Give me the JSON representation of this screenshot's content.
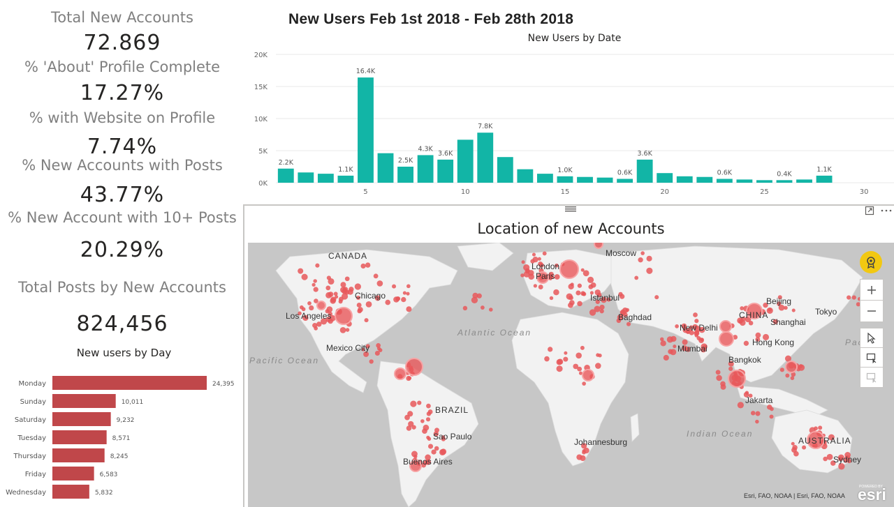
{
  "kpis": [
    {
      "label": "Total New Accounts",
      "value": "72.869"
    },
    {
      "label": "% 'About' Profile Complete",
      "value": "17.27%"
    },
    {
      "label": "% with Website on Profile",
      "value": "7.74%"
    },
    {
      "label": "% New Accounts with Posts",
      "value": "43.77%"
    },
    {
      "label": "% New Account with 10+ Posts",
      "value": "20.29%"
    },
    {
      "label": "Total Posts by New Accounts",
      "value": "824,456"
    }
  ],
  "day_chart": {
    "title": "New users by Day",
    "bar_color": "#c0474a",
    "items": [
      {
        "day": "Monday",
        "value": 24395,
        "label": "24,395"
      },
      {
        "day": "Sunday",
        "value": 10011,
        "label": "10,011"
      },
      {
        "day": "Saturday",
        "value": 9232,
        "label": "9,232"
      },
      {
        "day": "Tuesday",
        "value": 8571,
        "label": "8,571"
      },
      {
        "day": "Thursday",
        "value": 8245,
        "label": "8,245"
      },
      {
        "day": "Friday",
        "value": 6583,
        "label": "6,583"
      },
      {
        "day": "Wednesday",
        "value": 5832,
        "label": "5,832"
      }
    ]
  },
  "main_title": "New Users Feb 1st 2018 - Feb 28th 2018",
  "chart_data": [
    {
      "type": "bar",
      "title": "New Users by Date",
      "bar_color": "#12b5a6",
      "x": [
        1,
        2,
        3,
        4,
        5,
        6,
        7,
        8,
        9,
        10,
        11,
        12,
        13,
        14,
        15,
        16,
        17,
        18,
        19,
        20,
        21,
        22,
        23,
        24,
        25,
        26,
        27,
        28
      ],
      "values": [
        2200,
        1600,
        1400,
        1100,
        16400,
        4600,
        2500,
        4300,
        3600,
        6700,
        7800,
        4000,
        2100,
        1400,
        1000,
        900,
        800,
        600,
        3600,
        1500,
        1000,
        900,
        600,
        500,
        400,
        400,
        500,
        1100
      ],
      "data_labels": {
        "1": "2.2K",
        "4": "1.1K",
        "5": "16.4K",
        "7": "2.5K",
        "8": "4.3K",
        "9": "3.6K",
        "11": "7.8K",
        "15": "1.0K",
        "18": "0.6K",
        "19": "3.6K",
        "23": "0.6K",
        "26": "0.4K",
        "28": "1.1K"
      },
      "y_ticks": [
        "0K",
        "5K",
        "10K",
        "15K",
        "20K"
      ],
      "x_ticks": [
        "5",
        "10",
        "15",
        "20",
        "25",
        "30"
      ],
      "ylim": [
        0,
        20000
      ],
      "xlim": [
        0.5,
        31.5
      ],
      "grid": true
    },
    {
      "type": "bar",
      "title": "New users by Day",
      "categories": [
        "Monday",
        "Sunday",
        "Saturday",
        "Tuesday",
        "Thursday",
        "Friday",
        "Wednesday"
      ],
      "values": [
        24395,
        10011,
        9232,
        8571,
        8245,
        6583,
        5832
      ],
      "orientation": "horizontal"
    }
  ],
  "map": {
    "title": "Location of new Accounts",
    "land_color": "#f2f2f2",
    "water_color": "#c7c7c7",
    "dot_color": "#e8585a",
    "place_labels": [
      "CANADA",
      "Moscow",
      "London",
      "Paris",
      "Chicago",
      "Los Angeles",
      "Mexico City",
      "Istanbul",
      "Baghdad",
      "New Delhi",
      "Mumbai",
      "CHINA",
      "Beijing",
      "Shanghai",
      "Tokyo",
      "Hong Kong",
      "Bangkok",
      "Jakarta",
      "BRAZIL",
      "Sao Paulo",
      "Buenos Aires",
      "Johannesburg",
      "AUSTRALIA",
      "Sydney"
    ],
    "ocean_labels": [
      "Atlantic Ocean",
      "Pacific Ocean",
      "Indian Ocean",
      "Pacific"
    ],
    "attribution": "Esri, FAO, NOAA | Esri, FAO, NOAA",
    "powered_by": "POWERED BY",
    "esri": "esri"
  }
}
